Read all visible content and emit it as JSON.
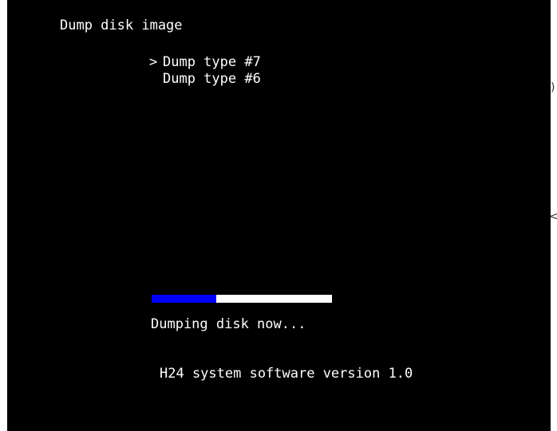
{
  "screen": {
    "title": "Dump disk image",
    "menu": {
      "cursor": ">",
      "items": [
        {
          "label": "Dump type #7",
          "selected": true
        },
        {
          "label": "Dump type #6",
          "selected": false
        }
      ]
    },
    "progress": {
      "fraction": 0.36,
      "fill_color": "#0000ff",
      "track_color": "#ffffff"
    },
    "status_text": "Dumping disk now...",
    "version_text": "H24 system software version 1.0"
  },
  "edge": {
    "mark_1": ")",
    "mark_2": "<"
  }
}
